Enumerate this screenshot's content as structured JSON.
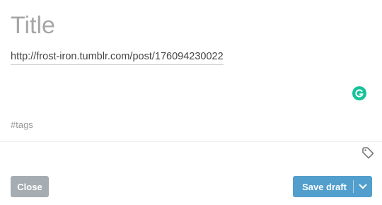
{
  "post": {
    "title_placeholder": "Title",
    "link_url": "http://frost-iron.tumblr.com/post/176094230022",
    "tags_placeholder": "#tags"
  },
  "icons": {
    "grammarly": "grammarly-icon",
    "tag": "tag-icon",
    "dropdown": "chevron-down-icon"
  },
  "footer": {
    "close_label": "Close",
    "save_label": "Save draft"
  },
  "colors": {
    "save_accent": "#529ecc",
    "close_bg": "#a5adb3",
    "grammarly": "#15c39a"
  }
}
